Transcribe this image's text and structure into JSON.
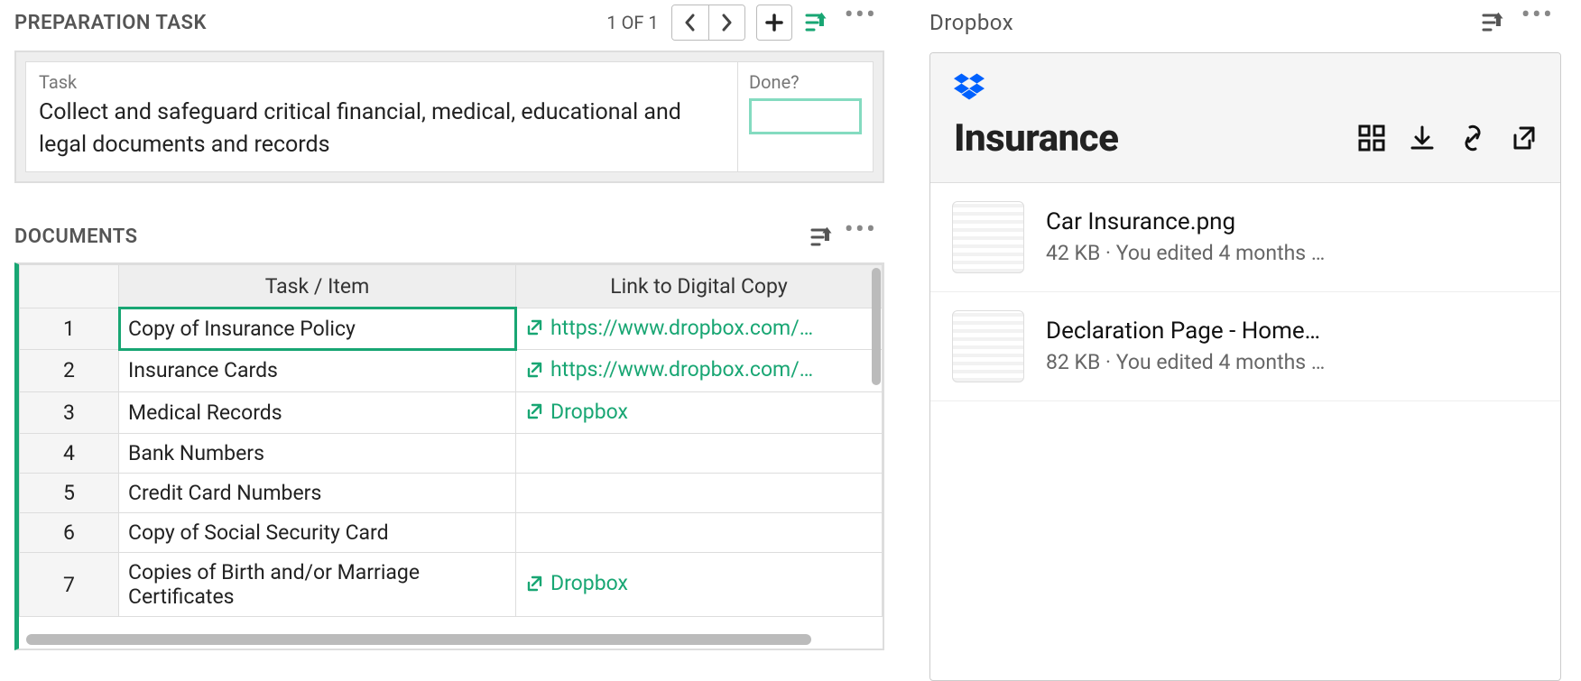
{
  "prep": {
    "pane_title": "PREPARATION TASK",
    "counter": "1 OF 1",
    "task_label": "Task",
    "task_text": "Collect and safeguard critical financial, medical, educational and legal documents and records",
    "done_label": "Done?"
  },
  "docs": {
    "pane_title": "DOCUMENTS",
    "col_item": "Task / Item",
    "col_link": "Link to Digital Copy",
    "rows": [
      {
        "n": "1",
        "item": "Copy of Insurance Policy",
        "link": "https://www.dropbox.com/…"
      },
      {
        "n": "2",
        "item": "Insurance Cards",
        "link": "https://www.dropbox.com/…"
      },
      {
        "n": "3",
        "item": "Medical Records",
        "link": "Dropbox"
      },
      {
        "n": "4",
        "item": "Bank Numbers",
        "link": ""
      },
      {
        "n": "5",
        "item": "Credit Card Numbers",
        "link": ""
      },
      {
        "n": "6",
        "item": "Copy of Social Security Card",
        "link": ""
      },
      {
        "n": "7",
        "item": "Copies of Birth and/or Marriage Certificates",
        "link": "Dropbox"
      }
    ]
  },
  "dropbox": {
    "pane_title": "Dropbox",
    "folder_title": "Insurance",
    "files": [
      {
        "name": "Car Insurance.png",
        "meta": "42 KB · You edited 4 months …"
      },
      {
        "name": "Declaration Page - Home…",
        "meta": "82 KB · You edited 4 months …"
      }
    ]
  }
}
